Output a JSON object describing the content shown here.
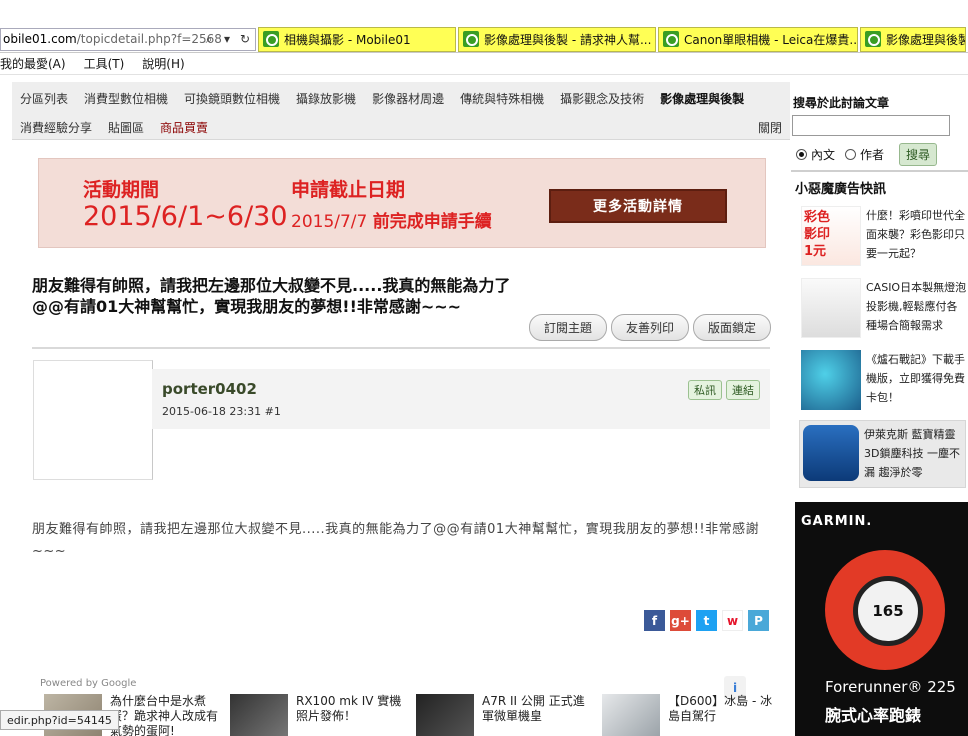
{
  "browser": {
    "address_host": "obile01.com",
    "address_path": "/topicdetail.php?f=2568",
    "tabs": [
      {
        "label": "相機與攝影 - Mobile01"
      },
      {
        "label": "影像處理與後製 - 請求神人幫..."
      },
      {
        "label": "Canon單眼相機 - Leica在爆貴..."
      },
      {
        "label": "影像處理與後製"
      }
    ],
    "menu": [
      "我的最愛(A)",
      "工具(T)",
      "說明(H)"
    ],
    "search_glyph": "⌕",
    "dropdown_glyph": "▾",
    "refresh_glyph": "↻"
  },
  "nav": {
    "row1": [
      "分區列表",
      "消費型數位相機",
      "可換鏡頭數位相機",
      "攝錄放影機",
      "影像器材周邊",
      "傳統與特殊相機",
      "攝影觀念及技術",
      "影像處理與後製"
    ],
    "row2": [
      "消費經驗分享",
      "貼圖區",
      "商品買賣"
    ],
    "close": "關閉"
  },
  "banner": {
    "label1": "活動期間",
    "date1": "2015/6/1~6/30",
    "label2": "申請截止日期",
    "date2_prefix": "2015/7/7",
    "date2_suffix": "前完成申請手續",
    "more": "更多活動詳情"
  },
  "topic": {
    "title": "朋友難得有帥照，請我把左邊那位大叔變不見.....我真的無能為力了@@有請01大神幫幫忙，實現我朋友的夢想!!非常感謝~~~",
    "actions": [
      "訂閱主題",
      "友善列印",
      "版面鎖定"
    ]
  },
  "post": {
    "username": "porter0402",
    "timestamp": "2015-06-18 23:31",
    "floor": "#1",
    "badge_pm": "私訊",
    "badge_link": "連結",
    "body": "朋友難得有帥照，請我把左邊那位大叔變不見.....我真的無能為力了@@有請01大神幫幫忙，實現我朋友的夢想!!非常感謝~~~"
  },
  "share": [
    {
      "icon": "facebook-icon",
      "glyph": "f",
      "color": "#3b5998"
    },
    {
      "icon": "googleplus-icon",
      "glyph": "g+",
      "color": "#dd4b39"
    },
    {
      "icon": "twitter-icon",
      "glyph": "t",
      "color": "#1da1f2"
    },
    {
      "icon": "weibo-icon",
      "glyph": "w",
      "color": "#e6162d"
    },
    {
      "icon": "plurk-icon",
      "glyph": "P",
      "color": "#4aa8d8"
    }
  ],
  "recommend": {
    "powered": "Powered by Google",
    "info_glyph": "i",
    "items": [
      {
        "text": "為什麼台中是水煮蛋？跪求神人改成有氣勢的蛋阿!"
      },
      {
        "text": "RX100 mk IV 實機照片發佈！"
      },
      {
        "text": "A7R II 公開 正式進軍微單機皇"
      },
      {
        "text": "【D600】冰島 - 冰島自駕行"
      }
    ]
  },
  "status_url": "edir.php?id=54145",
  "sidebar": {
    "search_title": "搜尋於此討論文章",
    "search_value": "",
    "radio_text": "內文",
    "radio_author": "作者",
    "search_button": "搜尋",
    "ad_heading": "小惡魔廣告快訊",
    "ads": [
      {
        "text": "什麼！彩噴印世代全面來襲？彩色影印只要一元起？"
      },
      {
        "text": "CASIO日本製無燈泡投影機,輕鬆應付各種場合簡報需求"
      },
      {
        "text": "《爐石戰記》下載手機版，立即獲得免費卡包！"
      },
      {
        "text": "伊萊克斯 藍寶精靈 3D鎖塵科技 一塵不漏 趨淨於零"
      }
    ],
    "garmin": {
      "brand": "GARMIN.",
      "watch_value": "165",
      "model": "Forerunner® 225",
      "tagline": "腕式心率跑錶"
    }
  }
}
